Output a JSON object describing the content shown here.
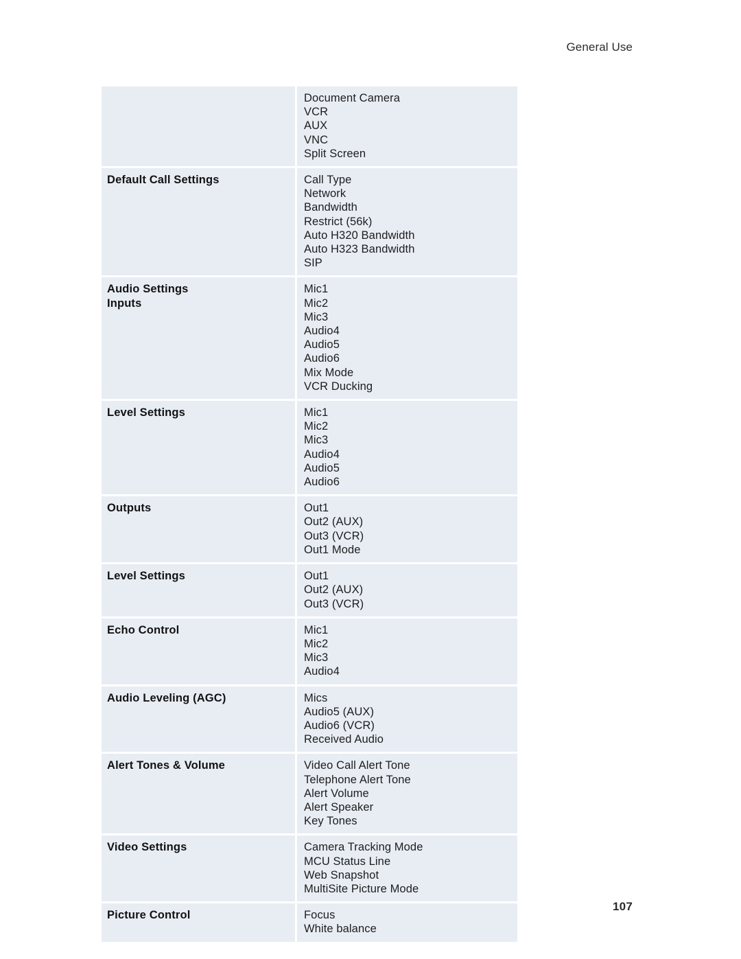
{
  "header": {
    "running_head": "General Use"
  },
  "footer": {
    "page_number": "107"
  },
  "table": {
    "rows": [
      {
        "label_lines": [],
        "items": [
          "Document Camera",
          "VCR",
          "AUX",
          "VNC",
          "Split Screen"
        ]
      },
      {
        "label_lines": [
          "Default Call Settings"
        ],
        "items": [
          "Call Type",
          "Network",
          "Bandwidth",
          "Restrict (56k)",
          "Auto H320 Bandwidth",
          "Auto H323 Bandwidth",
          "SIP"
        ]
      },
      {
        "label_lines": [
          "Audio Settings",
          "Inputs"
        ],
        "items": [
          "Mic1",
          "Mic2",
          "Mic3",
          "Audio4",
          "Audio5",
          "Audio6",
          "Mix Mode",
          "VCR Ducking"
        ]
      },
      {
        "label_lines": [
          "Level Settings"
        ],
        "items": [
          "Mic1",
          "Mic2",
          "Mic3",
          "Audio4",
          "Audio5",
          "Audio6"
        ]
      },
      {
        "label_lines": [
          "Outputs"
        ],
        "items": [
          "Out1",
          "Out2 (AUX)",
          "Out3 (VCR)",
          "Out1 Mode"
        ]
      },
      {
        "label_lines": [
          "Level Settings"
        ],
        "items": [
          "Out1",
          "Out2 (AUX)",
          "Out3 (VCR)"
        ]
      },
      {
        "label_lines": [
          "Echo Control"
        ],
        "items": [
          "Mic1",
          "Mic2",
          "Mic3",
          "Audio4"
        ]
      },
      {
        "label_lines": [
          "Audio Leveling (AGC)"
        ],
        "items": [
          "Mics",
          "Audio5 (AUX)",
          "Audio6 (VCR)",
          "Received Audio"
        ]
      },
      {
        "label_lines": [
          "Alert Tones & Volume"
        ],
        "items": [
          "Video Call Alert Tone",
          "Telephone Alert Tone",
          "Alert Volume",
          "Alert Speaker",
          "Key Tones"
        ]
      },
      {
        "label_lines": [
          "Video Settings"
        ],
        "items": [
          "Camera Tracking Mode",
          "MCU Status Line",
          "Web Snapshot",
          "MultiSite Picture Mode"
        ]
      },
      {
        "label_lines": [
          "Picture Control"
        ],
        "items": [
          "Focus",
          "White balance"
        ]
      }
    ]
  }
}
